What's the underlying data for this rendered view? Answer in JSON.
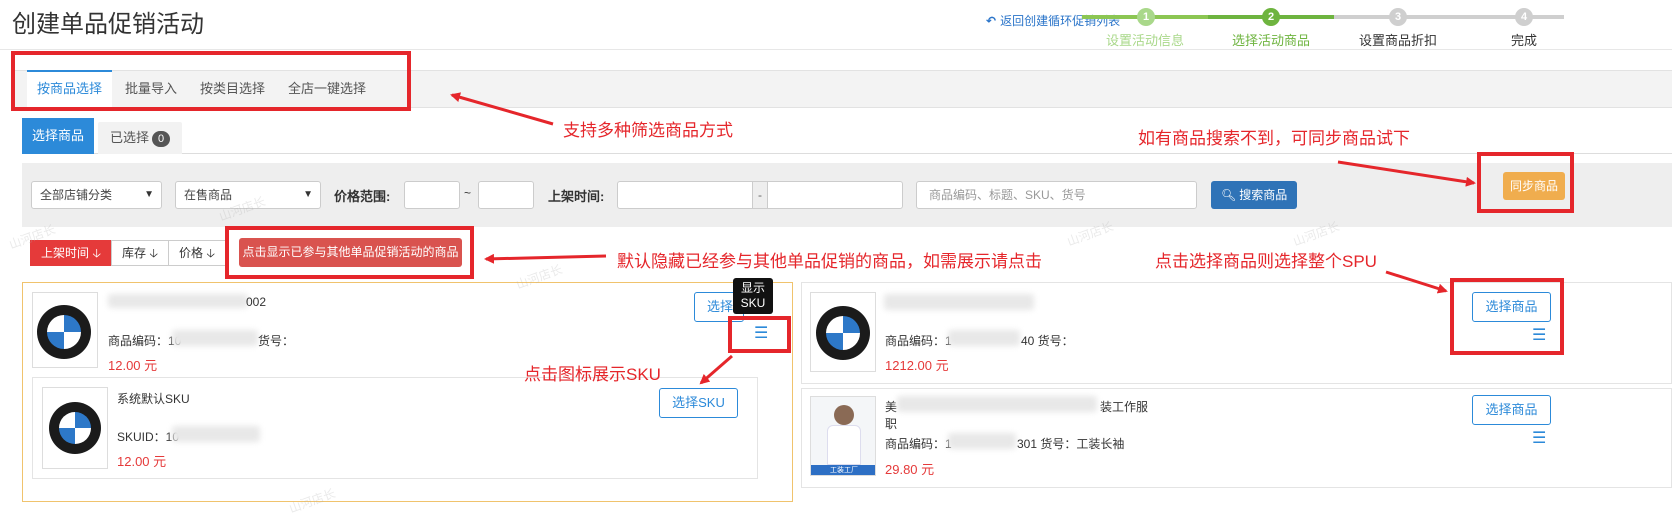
{
  "page": {
    "title": "创建单品促销活动",
    "back_link": "返回创建循环促销列表"
  },
  "steps": [
    {
      "num": "1",
      "label": "设置活动信息",
      "state": "done"
    },
    {
      "num": "2",
      "label": "选择活动商品",
      "state": "active"
    },
    {
      "num": "3",
      "label": "设置商品折扣",
      "state": "todo"
    },
    {
      "num": "4",
      "label": "完成",
      "state": "todo"
    }
  ],
  "tabs": [
    "按商品选择",
    "批量导入",
    "按类目选择",
    "全店一键选择"
  ],
  "subtabs": {
    "selected": "选择商品",
    "chosen": "已选择",
    "chosen_count": "0"
  },
  "filters": {
    "category": "全部店铺分类",
    "status": "在售商品",
    "price_label": "价格范围:",
    "range_sep": "~",
    "time_label": "上架时间:",
    "date_sep": "-",
    "search_placeholder": "商品编码、标题、SKU、货号",
    "search_button": "搜索商品",
    "sync_button": "同步商品"
  },
  "sort": {
    "time": "上架时间",
    "stock": "库存",
    "price": "价格",
    "show_hidden": "点击显示已参与其他单品促销活动的商品"
  },
  "products": {
    "left": {
      "title_tail": "002",
      "code_prefix": "商品编码：10",
      "code_suffix": "货号：",
      "price": "12.00 元",
      "select_btn": "选择",
      "tooltip_line1": "显示",
      "tooltip_line2": "SKU",
      "sku": {
        "name": "系统默认SKU",
        "skuid": "SKUID：10",
        "price": "12.00 元",
        "select_btn": "选择SKU"
      }
    },
    "right1": {
      "code_prefix": "商品编码：1",
      "code_suffix": "40 货号：",
      "price": "1212.00 元",
      "select_btn": "选择商品"
    },
    "right2": {
      "title_prefix": "美",
      "title_tail": "装工作服",
      "title_line2": "职",
      "code_prefix": "商品编码：1",
      "code_suffix": "301 货号：工装长袖",
      "price": "29.80 元",
      "select_btn": "选择商品",
      "thumb_caption": "工装工厂"
    }
  },
  "annotations": {
    "filter_modes": "支持多种筛选商品方式",
    "sync_hint": "如有商品搜索不到，可同步商品试下",
    "hidden_hint": "默认隐藏已经参与其他单品促销的商品，如需展示请点击",
    "spu_hint": "点击选择商品则选择整个SPU",
    "sku_hint": "点击图标展示SKU"
  },
  "watermark": "山河店长",
  "colors": {
    "accent": "#2c8ad9",
    "step_done": "#8cc653",
    "step_active": "#6eb43f",
    "annotation": "#e5262b",
    "price": "#e53a3a"
  }
}
